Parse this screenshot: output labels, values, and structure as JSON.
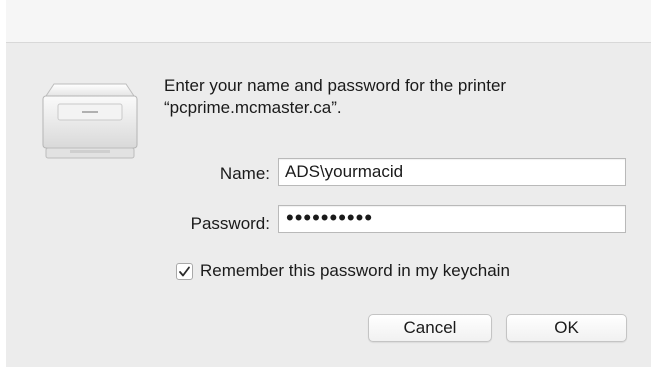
{
  "dialog": {
    "prompt_line1": "Enter your name and password for the printer",
    "prompt_line2": "“pcprime.mcmaster.ca”.",
    "icon": "printer-icon"
  },
  "form": {
    "name_label": "Name:",
    "name_value": "ADS\\yourmacid",
    "password_label": "Password:",
    "password_masked": "••••••••••",
    "remember_checked": true,
    "remember_label": "Remember this password in my keychain"
  },
  "buttons": {
    "cancel_label": "Cancel",
    "ok_label": "OK"
  }
}
